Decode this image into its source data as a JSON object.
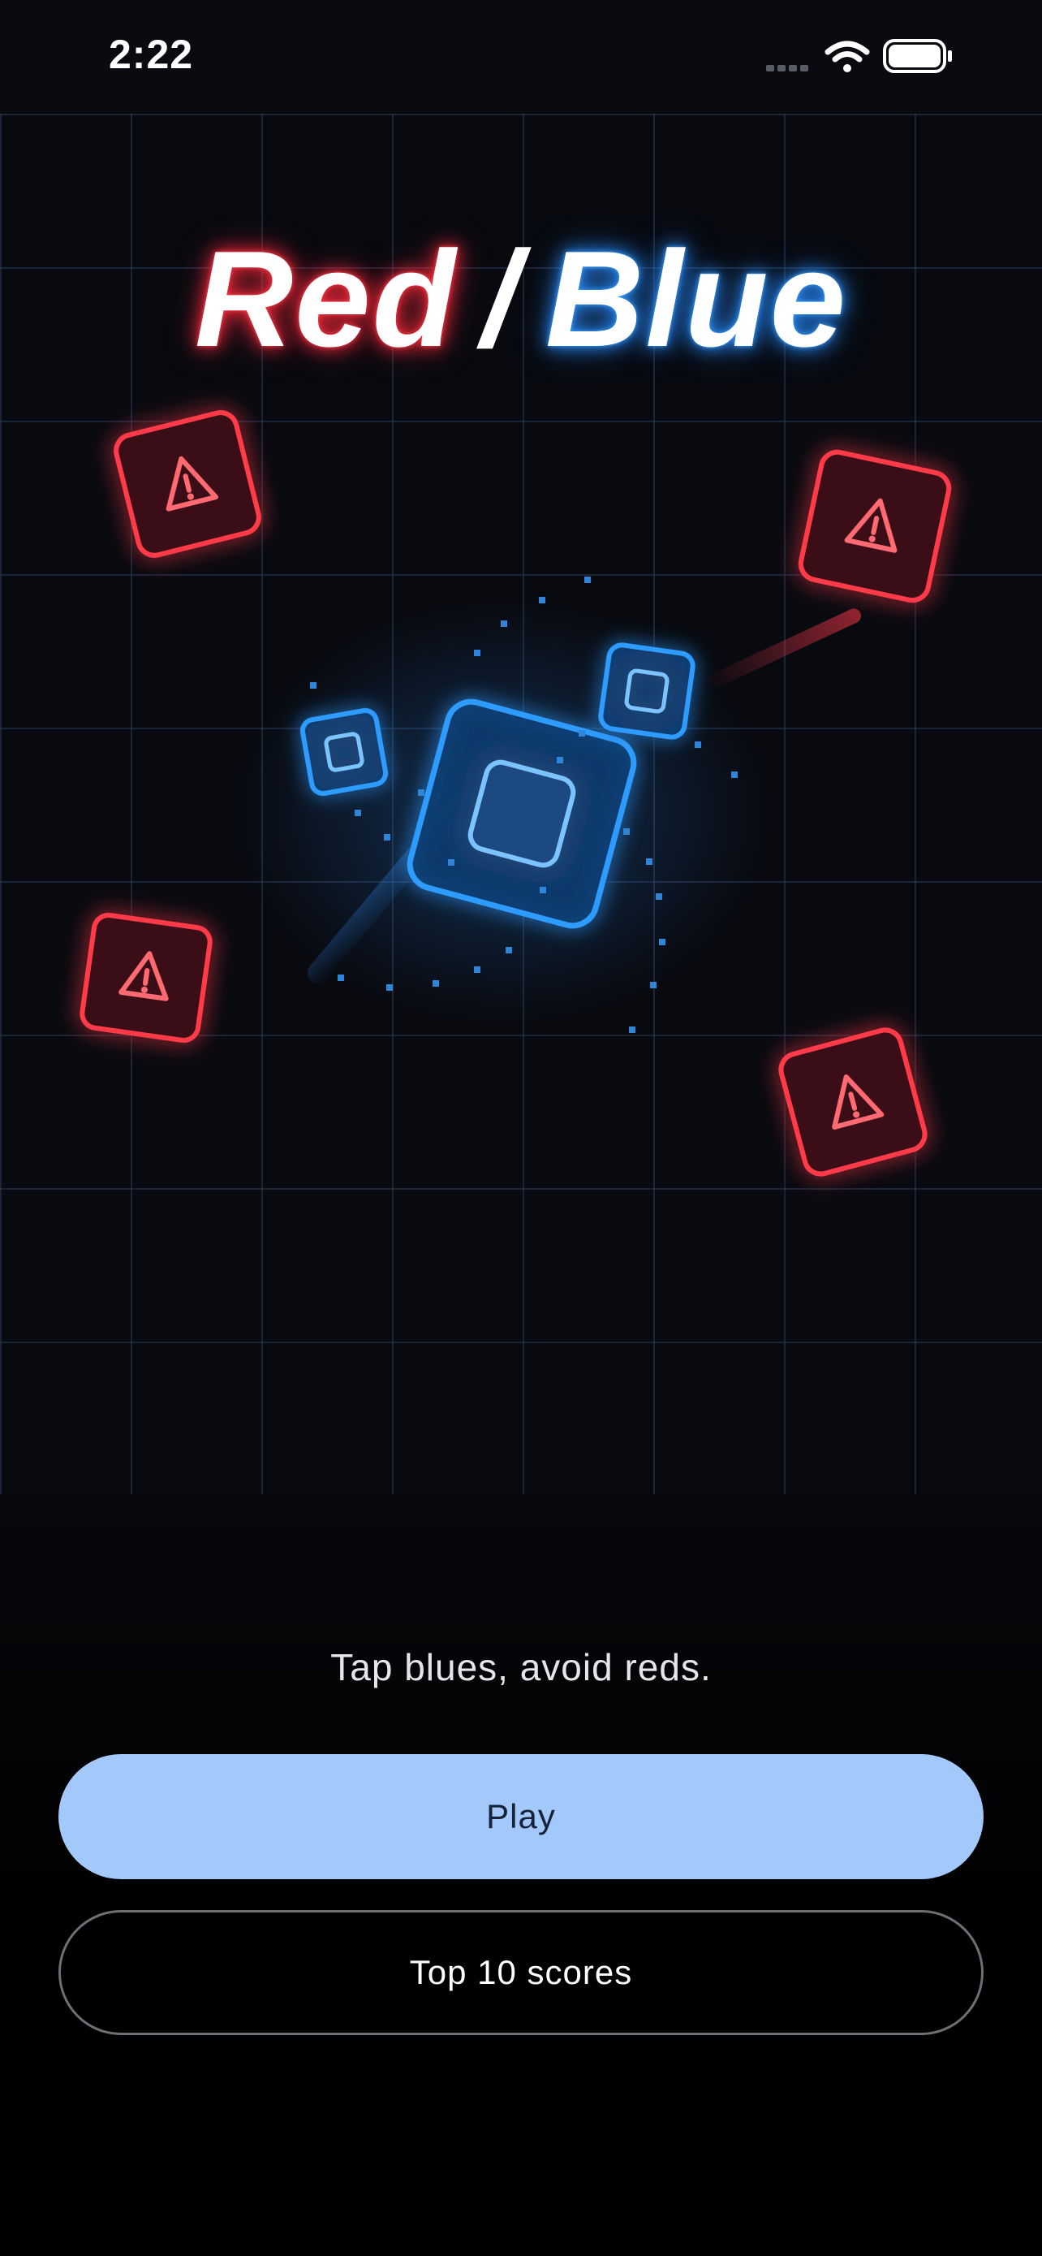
{
  "status_bar": {
    "time": "2:22"
  },
  "title": {
    "red": "Red",
    "slash": "/",
    "blue": "Blue"
  },
  "tagline": "Tap blues, avoid reds.",
  "buttons": {
    "play": "Play",
    "scores": "Top 10 scores"
  },
  "colors": {
    "accent_red": "#ff3b4a",
    "accent_blue": "#3aa0ff",
    "play_button": "#a3c9fa",
    "background": "#080a10"
  },
  "icons": {
    "red_tile_icon": "warning-triangle",
    "blue_tile_icon": "square-outline"
  }
}
